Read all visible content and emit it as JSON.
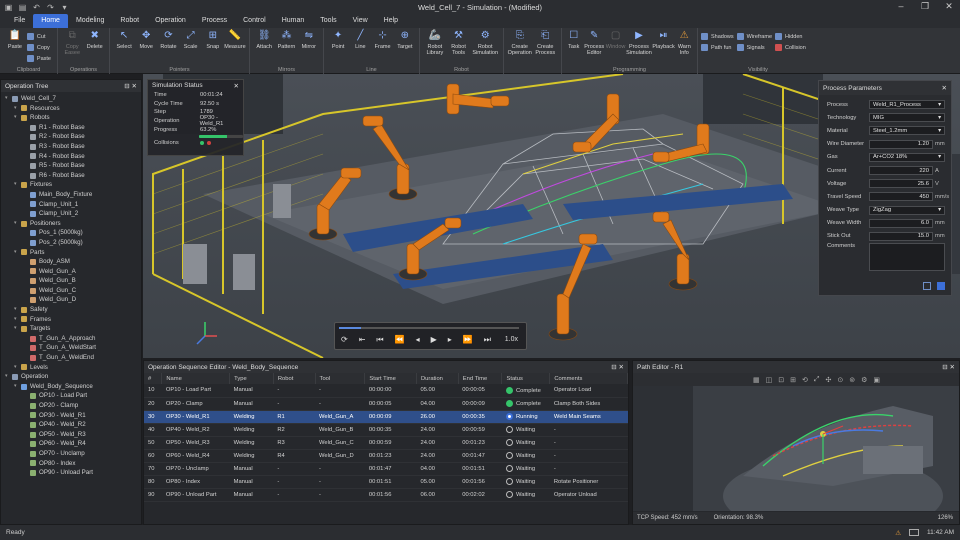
{
  "window": {
    "title": "Weld_Cell_7 - Simulation - (Modified)"
  },
  "menu": [
    "File",
    "Home",
    "Modeling",
    "Robot",
    "Operation",
    "Process",
    "Control",
    "Human",
    "Tools",
    "View",
    "Help"
  ],
  "ribbon": {
    "groups": [
      {
        "label": "Clipboard",
        "buttons": [
          "Paste"
        ],
        "small": [
          "Cut",
          "Copy",
          "Paste"
        ]
      },
      {
        "label": "Operations",
        "buttons": [
          "Copy Easee",
          "Delete"
        ]
      },
      {
        "label": "Pointers",
        "buttons": [
          "Select",
          "Move",
          "Rotate",
          "Scale",
          "Snap",
          "Measure"
        ]
      },
      {
        "label": "Mirrors",
        "buttons": [
          "Attach",
          "Pattern",
          "Mirror"
        ]
      },
      {
        "label": "Line",
        "buttons": [
          "Point",
          "Line",
          "Frame",
          "Target"
        ]
      },
      {
        "label": "Robot",
        "buttons": [
          "Robot Library",
          "Robot Tools",
          "Robot Simulation"
        ]
      },
      {
        "label": "",
        "buttons": [
          "Create Operation",
          "Create Process"
        ]
      },
      {
        "label": "Programming",
        "buttons": [
          "Task",
          "Process Editor",
          "Window",
          "Process Simulation",
          "Playback",
          "Warn Info"
        ]
      },
      {
        "label": "Visibility",
        "small": [
          "Shadows",
          "Path fun",
          "Wireframe",
          "Signals",
          "Hidden",
          "Collision"
        ]
      }
    ]
  },
  "tree": {
    "title": "Operation Tree",
    "nodes": [
      {
        "label": "Weld_Cell_7",
        "level": 0,
        "icon": "#8a9bb5"
      },
      {
        "label": "Resources",
        "level": 1,
        "icon": "#c9a44b"
      },
      {
        "label": "Robots",
        "level": 1,
        "icon": "#c9a44b"
      },
      {
        "label": "R1 - Robot Base",
        "level": 2,
        "icon": "#9aa0a8"
      },
      {
        "label": "R2 - Robot Base",
        "level": 2,
        "icon": "#9aa0a8"
      },
      {
        "label": "R3 - Robot Base",
        "level": 2,
        "icon": "#9aa0a8"
      },
      {
        "label": "R4 - Robot Base",
        "level": 2,
        "icon": "#9aa0a8"
      },
      {
        "label": "R5 - Robot Base",
        "level": 2,
        "icon": "#9aa0a8"
      },
      {
        "label": "R6 - Robot Base",
        "level": 2,
        "icon": "#9aa0a8"
      },
      {
        "label": "Fixtures",
        "level": 1,
        "icon": "#c9a44b"
      },
      {
        "label": "Main_Body_Fixture",
        "level": 2,
        "icon": "#7f9fd0"
      },
      {
        "label": "Clamp_Unit_1",
        "level": 2,
        "icon": "#7f9fd0"
      },
      {
        "label": "Clamp_Unit_2",
        "level": 2,
        "icon": "#7f9fd0"
      },
      {
        "label": "Positioners",
        "level": 1,
        "icon": "#c9a44b"
      },
      {
        "label": "Pos_1 (5000kg)",
        "level": 2,
        "icon": "#7f9fd0"
      },
      {
        "label": "Pos_2 (5000kg)",
        "level": 2,
        "icon": "#7f9fd0"
      },
      {
        "label": "Parts",
        "level": 1,
        "icon": "#c9a44b"
      },
      {
        "label": "Body_ASM",
        "level": 2,
        "icon": "#d0a070"
      },
      {
        "label": "Weld_Gun_A",
        "level": 2,
        "icon": "#d0a070"
      },
      {
        "label": "Weld_Gun_B",
        "level": 2,
        "icon": "#d0a070"
      },
      {
        "label": "Weld_Gun_C",
        "level": 2,
        "icon": "#d0a070"
      },
      {
        "label": "Weld_Gun_D",
        "level": 2,
        "icon": "#d0a070"
      },
      {
        "label": "Safety",
        "level": 1,
        "icon": "#c9a44b"
      },
      {
        "label": "Frames",
        "level": 1,
        "icon": "#c9a44b"
      },
      {
        "label": "Targets",
        "level": 1,
        "icon": "#c9a44b"
      },
      {
        "label": "T_Gun_A_Approach",
        "level": 2,
        "icon": "#d06a6a"
      },
      {
        "label": "T_Gun_A_WeldStart",
        "level": 2,
        "icon": "#d06a6a"
      },
      {
        "label": "T_Gun_A_WeldEnd",
        "level": 2,
        "icon": "#d06a6a"
      },
      {
        "label": "Levels",
        "level": 1,
        "icon": "#c9a44b"
      },
      {
        "label": "Operation",
        "level": 0,
        "icon": "#8a9bb5"
      },
      {
        "label": "Weld_Body_Sequence",
        "level": 1,
        "icon": "#6fa0e0"
      },
      {
        "label": "OP10 - Load Part",
        "level": 2,
        "icon": "#8ab070"
      },
      {
        "label": "OP20 - Clamp",
        "level": 2,
        "icon": "#8ab070"
      },
      {
        "label": "OP30 - Weld_R1",
        "level": 2,
        "icon": "#8ab070"
      },
      {
        "label": "OP40 - Weld_R2",
        "level": 2,
        "icon": "#8ab070"
      },
      {
        "label": "OP50 - Weld_R3",
        "level": 2,
        "icon": "#8ab070"
      },
      {
        "label": "OP60 - Weld_R4",
        "level": 2,
        "icon": "#8ab070"
      },
      {
        "label": "OP70 - Unclamp",
        "level": 2,
        "icon": "#8ab070"
      },
      {
        "label": "OP80 - Index",
        "level": 2,
        "icon": "#8ab070"
      },
      {
        "label": "OP90 - Unload Part",
        "level": 2,
        "icon": "#8ab070"
      }
    ]
  },
  "sim_status": {
    "title": "Simulation Status",
    "rows": [
      {
        "k": "Time",
        "v": "00:01:24"
      },
      {
        "k": "Cycle Time",
        "v": "92.50 s"
      },
      {
        "k": "Step",
        "v": "1789"
      },
      {
        "k": "Operation",
        "v": "OP30 - Weld_R1"
      },
      {
        "k": "Progress",
        "v": "63.2%"
      },
      {
        "k": "Collisions",
        "v": ""
      }
    ],
    "progress": 0.632
  },
  "process_params": {
    "title": "Process Parameters",
    "rows": [
      {
        "k": "Process",
        "v": "Weld_R1_Process",
        "type": "select"
      },
      {
        "k": "Technology",
        "v": "MIG",
        "type": "select"
      },
      {
        "k": "Material",
        "v": "Steel_1.2mm",
        "type": "select"
      },
      {
        "k": "Wire Diameter",
        "v": "1.20",
        "u": "mm",
        "type": "num"
      },
      {
        "k": "Gas",
        "v": "Ar+CO2 18%",
        "type": "select"
      },
      {
        "k": "Current",
        "v": "220",
        "u": "A",
        "type": "num"
      },
      {
        "k": "Voltage",
        "v": "25.6",
        "u": "V",
        "type": "num"
      },
      {
        "k": "Travel Speed",
        "v": "450",
        "u": "mm/s",
        "type": "num"
      },
      {
        "k": "Weave Type",
        "v": "ZigZag",
        "type": "select"
      },
      {
        "k": "Weave Width",
        "v": "6.0",
        "u": "mm",
        "type": "num"
      },
      {
        "k": "Stick Out",
        "v": "15.0",
        "u": "mm",
        "type": "num"
      },
      {
        "k": "Comments",
        "v": "",
        "type": "text"
      }
    ]
  },
  "playback": {
    "speed": "1.0x"
  },
  "sequence": {
    "title": "Operation Sequence Editor - Weld_Body_Sequence",
    "columns": [
      "#",
      "Name",
      "Type",
      "Robot",
      "Tool",
      "Start Time",
      "Duration",
      "End Time",
      "Status",
      "Comments"
    ],
    "rows": [
      [
        "10",
        "OP10 - Load Part",
        "Manual",
        "-",
        "-",
        "00:00:00",
        "05.00",
        "00:00:05",
        "Complete",
        "Operator Load"
      ],
      [
        "20",
        "OP20 - Clamp",
        "Manual",
        "-",
        "-",
        "00:00:05",
        "04.00",
        "00:00:09",
        "Complete",
        "Clamp Both Sides"
      ],
      [
        "30",
        "OP30 - Weld_R1",
        "Welding",
        "R1",
        "Weld_Gun_A",
        "00:00:09",
        "26.00",
        "00:00:35",
        "Running",
        "Weld Main Seams"
      ],
      [
        "40",
        "OP40 - Weld_R2",
        "Welding",
        "R2",
        "Weld_Gun_B",
        "00:00:35",
        "24.00",
        "00:00:59",
        "Waiting",
        "-"
      ],
      [
        "50",
        "OP50 - Weld_R3",
        "Welding",
        "R3",
        "Weld_Gun_C",
        "00:00:59",
        "24.00",
        "00:01:23",
        "Waiting",
        "-"
      ],
      [
        "60",
        "OP60 - Weld_R4",
        "Welding",
        "R4",
        "Weld_Gun_D",
        "00:01:23",
        "24.00",
        "00:01:47",
        "Waiting",
        "-"
      ],
      [
        "70",
        "OP70 - Unclamp",
        "Manual",
        "-",
        "-",
        "00:01:47",
        "04.00",
        "00:01:51",
        "Waiting",
        "-"
      ],
      [
        "80",
        "OP80 - Index",
        "Manual",
        "-",
        "-",
        "00:01:51",
        "05.00",
        "00:01:56",
        "Waiting",
        "Rotate Positioner"
      ],
      [
        "90",
        "OP90 - Unload Part",
        "Manual",
        "-",
        "-",
        "00:01:56",
        "06.00",
        "00:02:02",
        "Waiting",
        "Operator Unload"
      ]
    ],
    "selected_index": 2
  },
  "path_editor": {
    "title": "Path Editor - R1",
    "tcp_speed": "TCP Speed: 452 mm/s",
    "orientation": "Orientation: 98.3%",
    "zoom": "126%"
  },
  "statusbar": {
    "left": "Ready",
    "time": "11:42 AM"
  },
  "colors": {
    "accent": "#3c6fd8",
    "robot": "#e07a1c",
    "yellow": "#d7c62a",
    "complete": "#35c46a",
    "running": "#e08a2a"
  }
}
